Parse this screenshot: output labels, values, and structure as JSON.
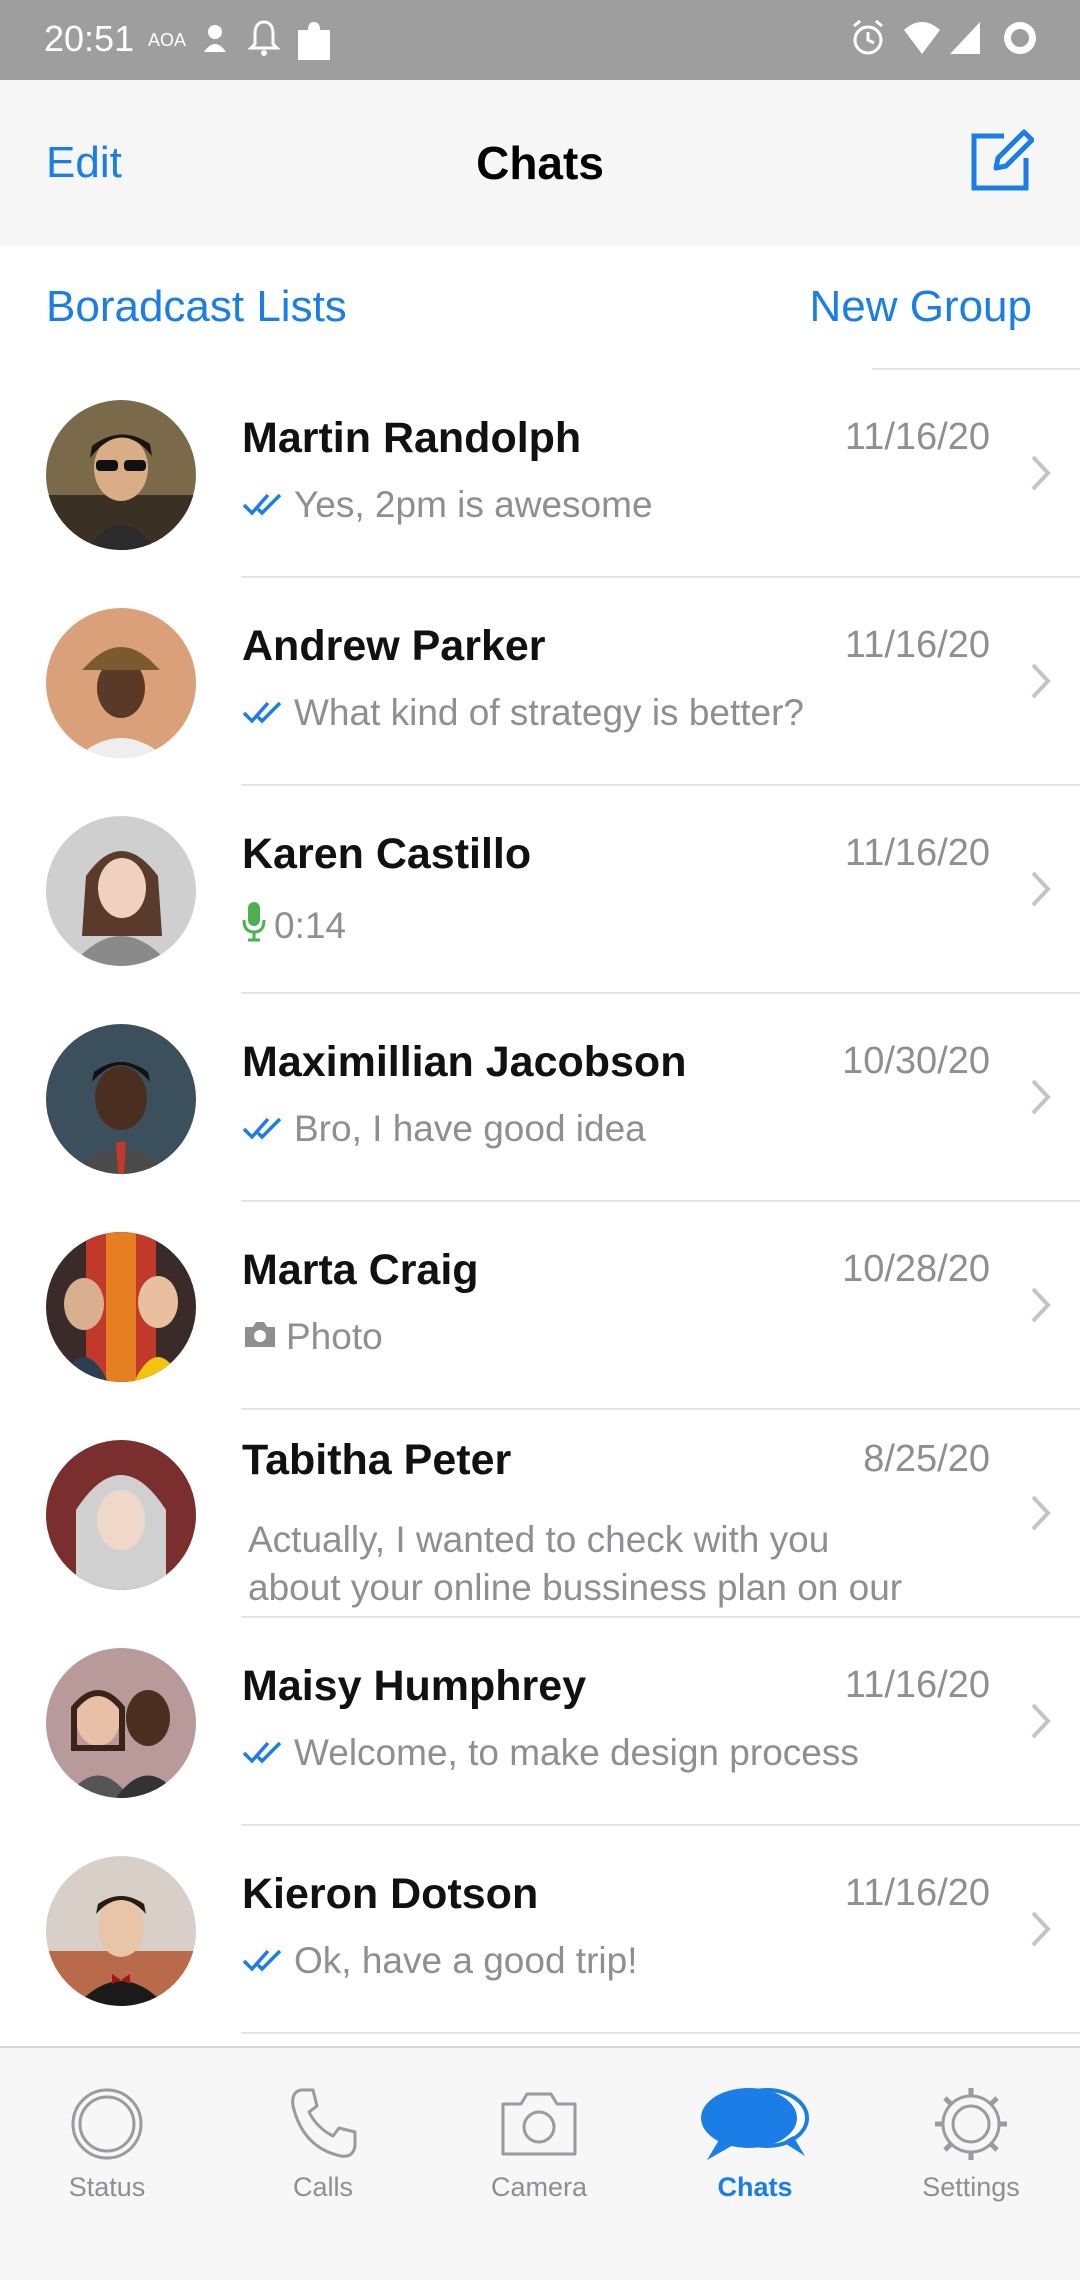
{
  "status_bar": {
    "time": "20:51",
    "carrier_label": "AOA"
  },
  "header": {
    "edit_label": "Edit",
    "title": "Chats"
  },
  "links": {
    "broadcast_label": "Boradcast Lists",
    "new_group_label": "New Group"
  },
  "chats": [
    {
      "name": "Martin Randolph",
      "date": "11/16/20",
      "preview": "Yes, 2pm is awesome",
      "preview_icon": "double-check-icon"
    },
    {
      "name": "Andrew Parker",
      "date": "11/16/20",
      "preview": "What kind of strategy is better?",
      "preview_icon": "double-check-icon"
    },
    {
      "name": "Karen Castillo",
      "date": "11/16/20",
      "preview": "0:14",
      "preview_icon": "microphone-icon"
    },
    {
      "name": "Maximillian Jacobson",
      "date": "10/30/20",
      "preview": "Bro, I have good idea",
      "preview_icon": "double-check-icon"
    },
    {
      "name": "Marta Craig",
      "date": "10/28/20",
      "preview": "Photo",
      "preview_icon": "camera-icon"
    },
    {
      "name": "Tabitha Peter",
      "date": "8/25/20",
      "preview_line1": "Actually, I wanted to check with you",
      "preview_line2": "about your online bussiness plan on our",
      "preview_icon": ""
    },
    {
      "name": "Maisy Humphrey",
      "date": "11/16/20",
      "preview": "Welcome, to make design process",
      "preview_icon": "double-check-icon"
    },
    {
      "name": "Kieron Dotson",
      "date": "11/16/20",
      "preview": "Ok, have a good trip!",
      "preview_icon": "double-check-icon"
    }
  ],
  "tabs": [
    {
      "label": "Status",
      "icon": "status-icon",
      "active": false
    },
    {
      "label": "Calls",
      "icon": "phone-icon",
      "active": false
    },
    {
      "label": "Camera",
      "icon": "camera-icon",
      "active": false
    },
    {
      "label": "Chats",
      "icon": "chat-bubbles-icon",
      "active": true
    },
    {
      "label": "Settings",
      "icon": "gear-icon",
      "active": false
    }
  ],
  "colors": {
    "accent": "#1a7ee6",
    "check": "#1a7ee6",
    "mic": "#4caf50",
    "secondary_text": "#8e8e93"
  }
}
